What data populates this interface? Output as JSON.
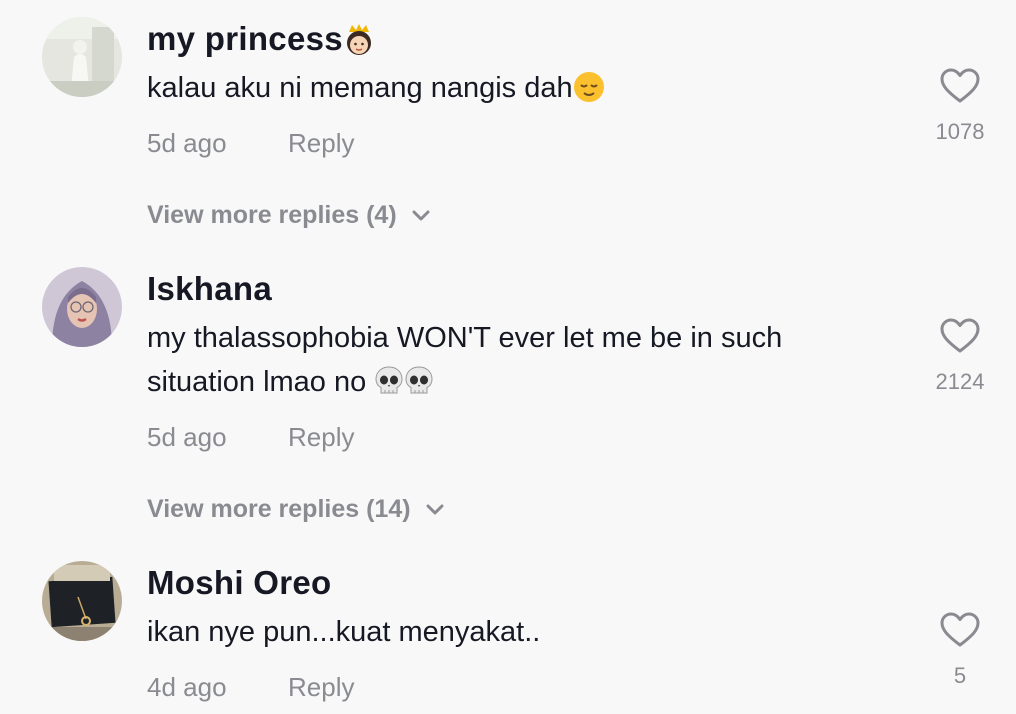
{
  "comments": [
    {
      "username": "my princess",
      "username_emoji": "princess",
      "text": "kalau aku ni memang nangis dah",
      "text_emoji": "relieved-face",
      "age": "5d ago",
      "reply_label": "Reply",
      "likes": "1078",
      "more_replies": "View more replies (4)"
    },
    {
      "username": "Iskhana",
      "text": "my thalassophobia WON'T ever let me be in such situation lmao no",
      "text_emoji": "skull x2",
      "age": "5d ago",
      "reply_label": "Reply",
      "likes": "2124",
      "more_replies": "View more replies (14)"
    },
    {
      "username": "Moshi Oreo",
      "text": "ikan nye pun...kuat menyakat..",
      "age": "4d ago",
      "reply_label": "Reply",
      "likes": "5"
    }
  ],
  "icons": {
    "like": "heart-outline-icon",
    "expand": "chevron-down-icon"
  },
  "colors": {
    "background": "#f8f8f8",
    "primary_text": "#161823",
    "secondary_text": "#8a8b91"
  }
}
